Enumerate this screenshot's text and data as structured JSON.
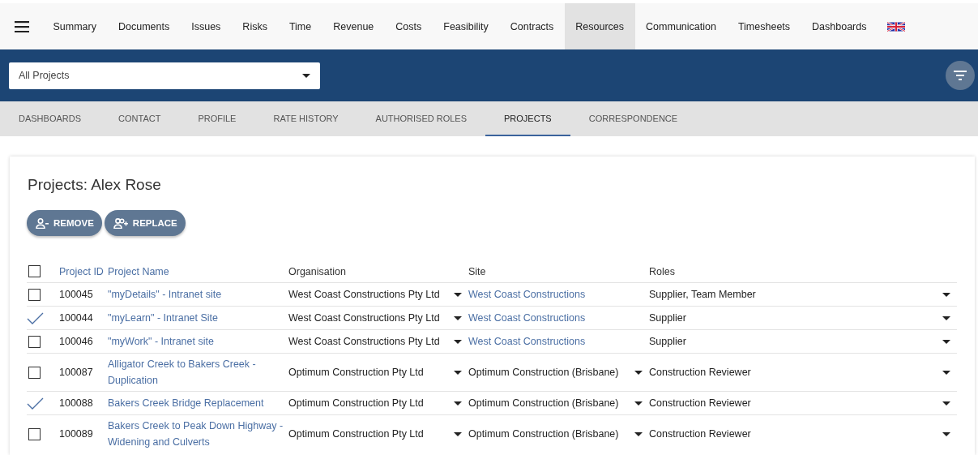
{
  "nav": {
    "items": [
      {
        "label": "Summary",
        "selected": false
      },
      {
        "label": "Documents",
        "selected": false
      },
      {
        "label": "Issues",
        "selected": false
      },
      {
        "label": "Risks",
        "selected": false
      },
      {
        "label": "Time",
        "selected": false
      },
      {
        "label": "Revenue",
        "selected": false
      },
      {
        "label": "Costs",
        "selected": false
      },
      {
        "label": "Feasibility",
        "selected": false
      },
      {
        "label": "Contracts",
        "selected": false
      },
      {
        "label": "Resources",
        "selected": true
      },
      {
        "label": "Communication",
        "selected": false
      },
      {
        "label": "Timesheets",
        "selected": false
      },
      {
        "label": "Dashboards",
        "selected": false
      }
    ]
  },
  "project_filter": {
    "value": "All Projects"
  },
  "subtabs": [
    {
      "label": "DASHBOARDS",
      "selected": false
    },
    {
      "label": "CONTACT",
      "selected": false
    },
    {
      "label": "PROFILE",
      "selected": false
    },
    {
      "label": "RATE HISTORY",
      "selected": false
    },
    {
      "label": "AUTHORISED ROLES",
      "selected": false
    },
    {
      "label": "PROJECTS",
      "selected": true
    },
    {
      "label": "CORRESPONDENCE",
      "selected": false
    }
  ],
  "card": {
    "title": "Projects: Alex Rose",
    "buttons": [
      {
        "label": "REMOVE",
        "kind": "remove"
      },
      {
        "label": "REPLACE",
        "kind": "replace"
      }
    ]
  },
  "table": {
    "select_all_checked": false,
    "columns": [
      "Project ID",
      "Project Name",
      "Organisation",
      "Site",
      "Roles"
    ],
    "rows": [
      {
        "checked": false,
        "id": "100045",
        "name": "\"myDetails\" - Intranet site",
        "organisation": "West Coast Constructions Pty Ltd",
        "site": {
          "kind": "link",
          "text": "West Coast Constructions"
        },
        "roles": "Supplier, Team Member"
      },
      {
        "checked": true,
        "id": "100044",
        "name": "\"myLearn\" - Intranet Site",
        "organisation": "West Coast Constructions Pty Ltd",
        "site": {
          "kind": "link",
          "text": "West Coast Constructions"
        },
        "roles": "Supplier"
      },
      {
        "checked": false,
        "id": "100046",
        "name": "\"myWork\" - Intranet site",
        "organisation": "West Coast Constructions Pty Ltd",
        "site": {
          "kind": "link",
          "text": "West Coast Constructions"
        },
        "roles": "Supplier"
      },
      {
        "checked": false,
        "id": "100087",
        "name": "Alligator Creek to Bakers Creek - Duplication",
        "organisation": "Optimum Construction Pty Ltd",
        "site": {
          "kind": "select",
          "text": "Optimum Construction (Brisbane)"
        },
        "roles": "Construction Reviewer"
      },
      {
        "checked": true,
        "id": "100088",
        "name": "Bakers Creek Bridge Replacement",
        "organisation": "Optimum Construction Pty Ltd",
        "site": {
          "kind": "select",
          "text": "Optimum Construction (Brisbane)"
        },
        "roles": "Construction Reviewer"
      },
      {
        "checked": false,
        "id": "100089",
        "name": "Bakers Creek to Peak Down Highway - Widening and Culverts",
        "organisation": "Optimum Construction Pty Ltd",
        "site": {
          "kind": "select",
          "text": "Optimum Construction (Brisbane)"
        },
        "roles": "Construction Reviewer"
      }
    ]
  }
}
